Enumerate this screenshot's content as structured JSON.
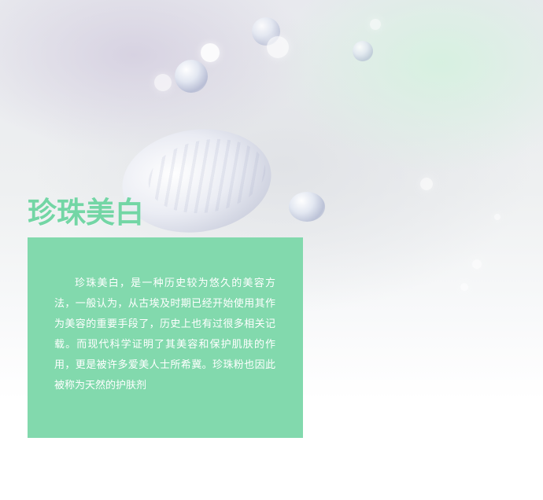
{
  "header": {
    "title": "珍珠美白"
  },
  "content": {
    "paragraph": "珍珠美白，是一种历史较为悠久的美容方法，一般认为，从古埃及时期已经开始使用其作为美容的重要手段了，历史上也有过很多相关记载。而现代科学证明了其美容和保护肌肤的作用，更是被许多爱美人士所希冀。珍珠粉也因此被称为天然的护肤剂"
  },
  "colors": {
    "title": "#73d6a5",
    "card": "#82d9ad",
    "text": "#ffffff"
  }
}
